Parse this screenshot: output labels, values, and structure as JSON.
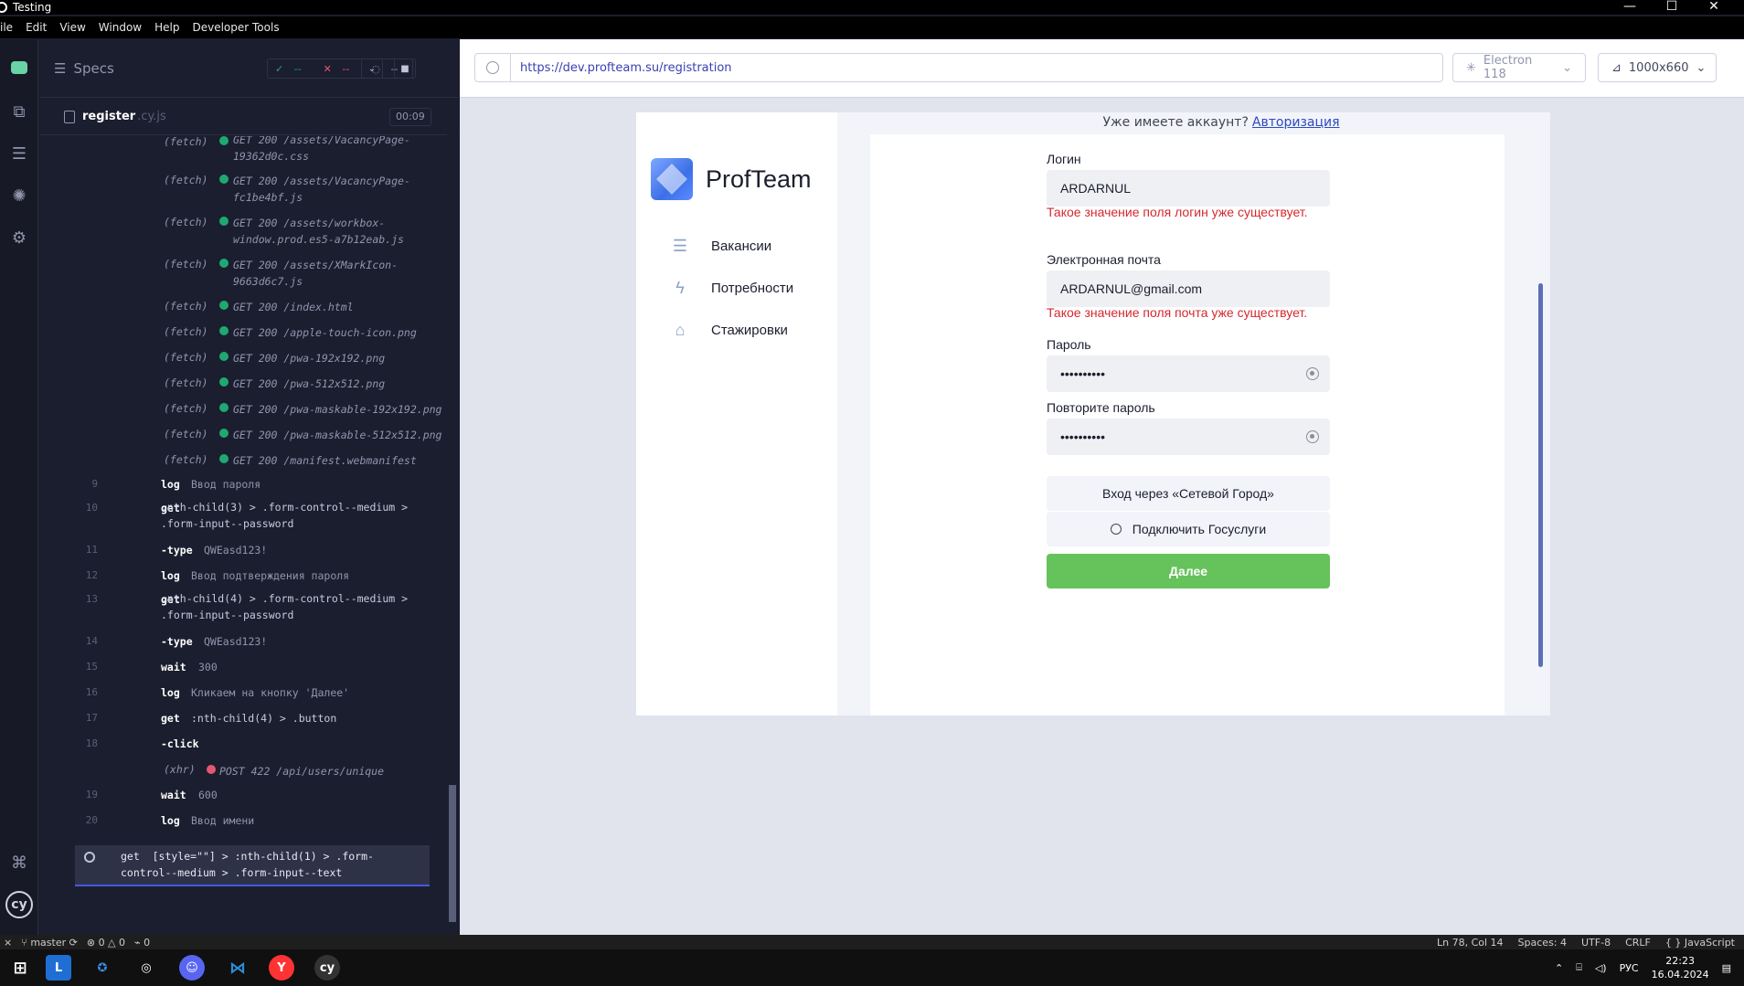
{
  "window": {
    "title": "Testing",
    "controls": [
      "—",
      "☐",
      "✕"
    ]
  },
  "menu": [
    "ile",
    "Edit",
    "View",
    "Window",
    "Help",
    "Developer Tools"
  ],
  "specs": {
    "label": "Specs",
    "passed": "--",
    "failed": "--",
    "pending": "--",
    "file_name": "register",
    "file_ext": ".cy.js",
    "duration": "00:09"
  },
  "log": {
    "fetch_rows": [
      {
        "type": "(fetch)",
        "text": "GET 200 /assets/VacancyPage-\n19362d0c.css"
      },
      {
        "type": "(fetch)",
        "text": "GET 200 /assets/VacancyPage-\nfc1be4bf.js"
      },
      {
        "type": "(fetch)",
        "text": "GET 200 /assets/workbox-\nwindow.prod.es5-a7b12eab.js"
      },
      {
        "type": "(fetch)",
        "text": "GET 200 /assets/XMarkIcon-\n9663d6c7.js"
      },
      {
        "type": "(fetch)",
        "text": "GET 200 /index.html"
      },
      {
        "type": "(fetch)",
        "text": "GET 200 /apple-touch-icon.png"
      },
      {
        "type": "(fetch)",
        "text": "GET 200 /pwa-192x192.png"
      },
      {
        "type": "(fetch)",
        "text": "GET 200 /pwa-512x512.png"
      },
      {
        "type": "(fetch)",
        "text": "GET 200 /pwa-maskable-192x192.png"
      },
      {
        "type": "(fetch)",
        "text": "GET 200 /pwa-maskable-512x512.png"
      },
      {
        "type": "(fetch)",
        "text": "GET 200 /manifest.webmanifest"
      }
    ],
    "commands": [
      {
        "num": "9",
        "cmd": "log",
        "msg": "Ввод пароля"
      },
      {
        "num": "10",
        "cmd": "get",
        "msg": ":nth-child(3) > .form-control--medium >\n.form-input--password"
      },
      {
        "num": "11",
        "cmd": "-type",
        "msg": "QWEasd123!"
      },
      {
        "num": "12",
        "cmd": "log",
        "msg": "Ввод подтверждения пароля"
      },
      {
        "num": "13",
        "cmd": "get",
        "msg": ":nth-child(4) > .form-control--medium >\n.form-input--password"
      },
      {
        "num": "14",
        "cmd": "-type",
        "msg": "QWEasd123!"
      },
      {
        "num": "15",
        "cmd": "wait",
        "msg": "300"
      },
      {
        "num": "16",
        "cmd": "log",
        "msg": "Кликаем на кнопку 'Далее'"
      },
      {
        "num": "17",
        "cmd": "get",
        "msg": ":nth-child(4) > .button"
      },
      {
        "num": "18",
        "cmd": "-click",
        "msg": ""
      },
      {
        "num": "",
        "cmd": "(xhr)",
        "msg": "POST 422 /api/users/unique"
      },
      {
        "num": "19",
        "cmd": "wait",
        "msg": "600"
      },
      {
        "num": "20",
        "cmd": "log",
        "msg": "Ввод имени"
      }
    ],
    "active": "get  [style=\"\"] > :nth-child(1) > .form-\ncontrol--medium > .form-input--text"
  },
  "browser": {
    "url": "https://dev.profteam.su/registration",
    "engine": "Electron 118",
    "viewport": "1000x660"
  },
  "app": {
    "brand": "ProfTeam",
    "nav": [
      "Вакансии",
      "Потребности",
      "Стажировки"
    ],
    "already_text": "Уже имеете аккаунт?",
    "login_link": "Авторизация",
    "login_label": "Логин",
    "login_value": "ARDARNUL",
    "login_error": "Такое значение поля логин уже существует.",
    "email_label": "Электронная почта",
    "email_value": "ARDARNUL@gmail.com",
    "email_error": "Такое значение поля почта уже существует.",
    "password_label": "Пароль",
    "password_value": "••••••••••",
    "repeat_label": "Повторите пароль",
    "repeat_value": "••••••••••",
    "net_city_button": "Вход через «Сетевой Город»",
    "gosuslugi_button": "Подключить Госуслуги",
    "next_button": "Далее"
  },
  "statusbar": {
    "branch": "master",
    "errors": "0",
    "warnings": "0",
    "ports": "0",
    "position": "Ln 78, Col 14",
    "spaces": "Spaces: 4",
    "encoding": "UTF-8",
    "eol": "CRLF",
    "language": "JavaScript"
  },
  "taskbar": {
    "lang": "РУС",
    "time": "22:23",
    "date": "16.04.2024"
  }
}
